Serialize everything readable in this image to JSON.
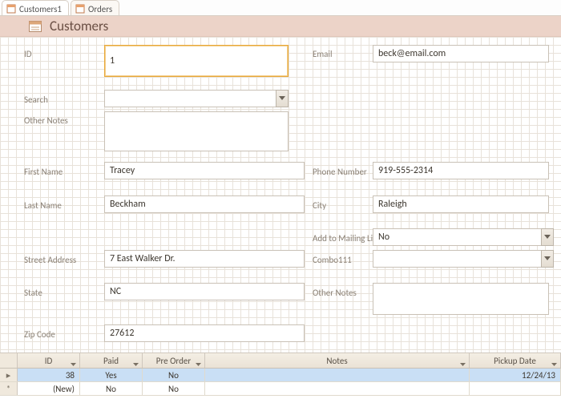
{
  "tabs": {
    "customers": "Customers1",
    "orders": "Orders"
  },
  "header": {
    "title": "Customers"
  },
  "labels": {
    "id": "ID",
    "search": "Search",
    "other1": "Other Notes",
    "firstname": "First Name",
    "lastname": "Last Name",
    "street": "Street Address",
    "state": "State",
    "zip": "Zip Code",
    "email": "Email",
    "phone": "Phone Number",
    "city": "City",
    "mailing": "Add to Mailing List?",
    "combo111": "Combo111",
    "other2": "Other Notes"
  },
  "fields": {
    "id": "1",
    "search": "",
    "other1": "",
    "firstname": "Tracey",
    "lastname": "Beckham",
    "street": "7 East Walker Dr.",
    "state": "NC",
    "zip": "27612",
    "email": "beck@email.com",
    "phone": "919-555-2314",
    "city": "Raleigh",
    "mailing": "No",
    "combo111": "",
    "other2": ""
  },
  "subform": {
    "headers": {
      "id": "ID",
      "paid": "Paid",
      "preorder": "Pre Order",
      "notes": "Notes",
      "pickup": "Pickup Date"
    },
    "rows": [
      {
        "id": "38",
        "paid": "Yes",
        "preorder": "No",
        "notes": "",
        "pickup": "12/24/13"
      }
    ],
    "newRow": {
      "id": "(New)",
      "paid": "No",
      "preorder": "No",
      "notes": "",
      "pickup": ""
    },
    "markers": {
      "current": "▸",
      "new": "*"
    }
  }
}
